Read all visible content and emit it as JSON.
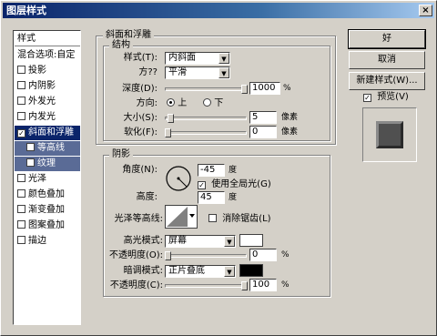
{
  "window": {
    "title": "图层样式",
    "close": "×"
  },
  "sidebar": {
    "header": "样式",
    "items": [
      {
        "label": "混合选项:自定",
        "checkbox": false,
        "checked": false,
        "state": "normal"
      },
      {
        "label": "投影",
        "checkbox": true,
        "checked": false,
        "state": "normal"
      },
      {
        "label": "内阴影",
        "checkbox": true,
        "checked": false,
        "state": "normal"
      },
      {
        "label": "外发光",
        "checkbox": true,
        "checked": false,
        "state": "normal"
      },
      {
        "label": "内发光",
        "checkbox": true,
        "checked": false,
        "state": "normal"
      },
      {
        "label": "斜面和浮雕",
        "checkbox": true,
        "checked": true,
        "state": "selected"
      },
      {
        "label": "等高线",
        "checkbox": true,
        "checked": false,
        "state": "sub"
      },
      {
        "label": "纹理",
        "checkbox": true,
        "checked": false,
        "state": "sub"
      },
      {
        "label": "光泽",
        "checkbox": true,
        "checked": false,
        "state": "normal"
      },
      {
        "label": "颜色叠加",
        "checkbox": true,
        "checked": false,
        "state": "normal"
      },
      {
        "label": "渐变叠加",
        "checkbox": true,
        "checked": false,
        "state": "normal"
      },
      {
        "label": "图案叠加",
        "checkbox": true,
        "checked": false,
        "state": "normal"
      },
      {
        "label": "描边",
        "checkbox": true,
        "checked": false,
        "state": "normal"
      }
    ]
  },
  "bevel": {
    "title": "斜面和浮雕",
    "structure_title": "结构",
    "style_label": "样式(T):",
    "style_value": "内斜面",
    "technique_label": "方??",
    "technique_value": "平滑",
    "depth_label": "深度(D):",
    "depth_value": "1000",
    "depth_unit": "%",
    "depth_level": 1.0,
    "direction_label": "方向:",
    "dir_up": "上",
    "dir_down": "下",
    "direction_selected": "上",
    "size_label": "大小(S):",
    "size_value": "5",
    "size_unit": "像素",
    "size_level": 0.04,
    "soften_label": "软化(F):",
    "soften_value": "0",
    "soften_unit": "像素",
    "soften_level": 0.0
  },
  "shading": {
    "title": "阴影",
    "angle_label": "角度(N):",
    "angle_value": "-45",
    "angle_unit": "度",
    "global_light_label": "使用全局光(G)",
    "global_light_checked": true,
    "altitude_label": "高度:",
    "altitude_value": "45",
    "altitude_unit": "度",
    "gloss_label": "光泽等高线:",
    "antialias_label": "消除锯齿(L)",
    "antialias_checked": false,
    "highlight_mode_label": "高光模式:",
    "highlight_mode_value": "屏幕",
    "highlight_color": "#ffffff",
    "highlight_opacity_label": "不透明度(O):",
    "highlight_opacity_value": "0",
    "highlight_opacity_unit": "%",
    "highlight_opacity_level": 0.0,
    "shadow_mode_label": "暗调模式:",
    "shadow_mode_value": "正片叠底",
    "shadow_color": "#000000",
    "shadow_opacity_label": "不透明度(C):",
    "shadow_opacity_value": "100",
    "shadow_opacity_unit": "%",
    "shadow_opacity_level": 1.0
  },
  "buttons": {
    "ok": "好",
    "cancel": "取消",
    "new_style": "新建样式(W)...",
    "preview_label": "预览(V)",
    "preview_checked": true
  },
  "colors": {
    "dialog_bg": "#d4d0c8",
    "selection": "#0a246a",
    "sub_selection": "#5a6b96"
  }
}
